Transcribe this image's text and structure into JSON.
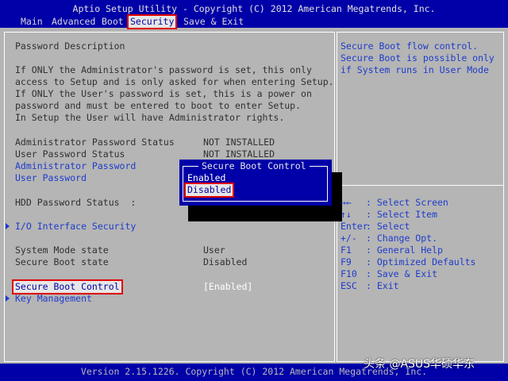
{
  "header": {
    "title": "Aptio Setup Utility - Copyright (C) 2012 American Megatrends, Inc.",
    "tabs": [
      "Main",
      "Advanced",
      "Boot",
      "Security",
      "Save & Exit"
    ],
    "active_tab": "Security"
  },
  "main": {
    "description_title": "Password Description",
    "description_lines": [
      "If ONLY the Administrator's password is set, this only",
      "access to Setup and is only asked for when entering Setup.",
      "If ONLY the User's password is set, this is a power on",
      "password and must be entered to boot to enter Setup.",
      "In Setup the User will have Administrator rights."
    ],
    "admin_status_label": "Administrator Password Status",
    "admin_status_value": "NOT INSTALLED",
    "user_status_label": "User Password Status",
    "user_status_value": "NOT INSTALLED",
    "admin_password_link": "Administrator Password",
    "user_password_link": "User Password",
    "hdd_status_label": "HDD Password Status  :",
    "io_security_link": "I/O Interface Security",
    "system_mode_label": "System Mode state",
    "system_mode_value": "User",
    "secure_boot_state_label": "Secure Boot state",
    "secure_boot_state_value": "Disabled",
    "secure_boot_control_label": "Secure Boot Control",
    "secure_boot_control_value": "[Enabled]",
    "key_management_link": "Key Management"
  },
  "popup": {
    "title": "Secure Boot Control",
    "options": [
      "Enabled",
      "Disabled"
    ],
    "selected": "Disabled"
  },
  "help": {
    "lines": [
      "Secure Boot flow control.",
      "Secure Boot is possible only",
      "if System runs in User Mode"
    ]
  },
  "keys": [
    {
      "key": "→←",
      "action": ": Select Screen"
    },
    {
      "key": "↑↓",
      "action": ": Select Item"
    },
    {
      "key": "Enter",
      "action": ": Select"
    },
    {
      "key": "+/-",
      "action": ": Change Opt."
    },
    {
      "key": "F1",
      "action": ": General Help"
    },
    {
      "key": "F9",
      "action": ": Optimized Defaults"
    },
    {
      "key": "F10",
      "action": ": Save & Exit"
    },
    {
      "key": "ESC",
      "action": ": Exit"
    }
  ],
  "footer": {
    "text": "Version 2.15.1226. Copyright (C) 2012 American Megatrends, Inc."
  },
  "watermark": "头条 @ASUS华硕华东",
  "colors": {
    "header_bg": "#0000a8",
    "panel_bg": "#b5b5b5",
    "link_blue": "#1e3ccc",
    "highlight_red": "#e00000"
  }
}
